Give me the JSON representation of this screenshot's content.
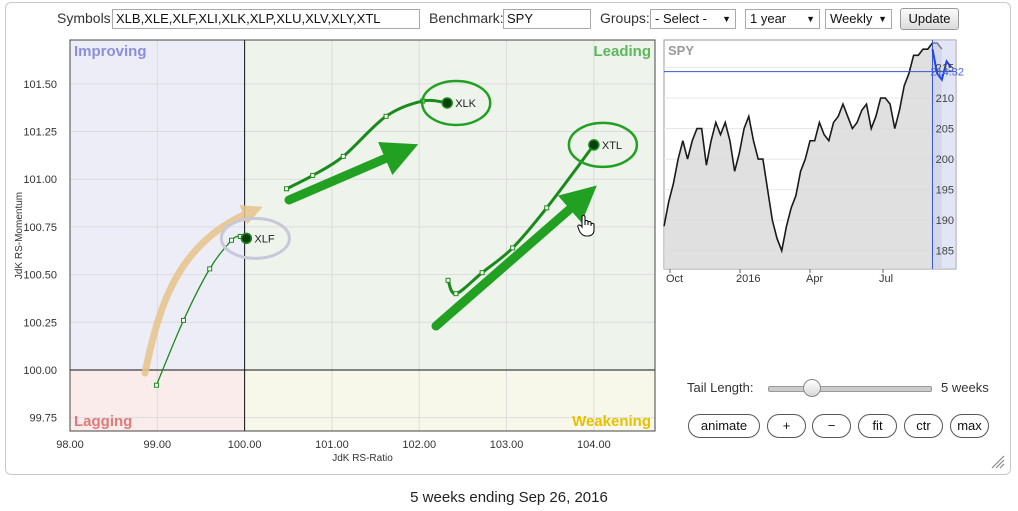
{
  "controls": {
    "symbols_label": "Symbols:",
    "symbols_value": "XLB,XLE,XLF,XLI,XLK,XLP,XLU,XLV,XLY,XTL",
    "benchmark_label": "Benchmark:",
    "benchmark_value": "SPY",
    "groups_label": "Groups:",
    "groups_value": "- Select -",
    "period_value": "1 year",
    "frequency_value": "Weekly",
    "update_label": "Update"
  },
  "playback": {
    "tail_label": "Tail Length:",
    "tail_value": "5 weeks",
    "tail_level": 5,
    "buttons": {
      "animate": "animate",
      "plus": "+",
      "minus": "−",
      "fit": "fit",
      "ctr": "ctr",
      "max": "max"
    }
  },
  "caption": "5 weeks ending Sep 26, 2016",
  "colors": {
    "improving": "#ededf8",
    "leading": "#eef4ec",
    "lagging": "#fbecec",
    "weakening": "#f8f8ea",
    "improving_text": "#8a8fd8",
    "leading_text": "#5cb85c",
    "lagging_text": "#e07a7a",
    "weakening_text": "#e8c000",
    "tail_color": "#1a8a1a",
    "arrow_color": "#22a022",
    "tan_arrow": "#e8c58a",
    "spy_line": "#1a1a1a",
    "spy_tail": "#2244dd"
  },
  "chart_data": [
    {
      "type": "scatter",
      "xlabel": "JdK RS-Ratio",
      "ylabel": "JdK RS-Momentum",
      "xlim": [
        98.0,
        104.7
      ],
      "ylim": [
        99.68,
        101.73
      ],
      "xticks": [
        "98.00",
        "99.00",
        "100.00",
        "101.00",
        "102.00",
        "103.00",
        "104.00"
      ],
      "yticks": [
        "99.75",
        "100.00",
        "100.25",
        "100.50",
        "100.75",
        "101.00",
        "101.25",
        "101.50"
      ],
      "quadrants": {
        "improving": "Improving",
        "leading": "Leading",
        "lagging": "Lagging",
        "weakening": "Weakening"
      },
      "series": [
        {
          "name": "XLF",
          "points": [
            [
              98.99,
              99.92
            ],
            [
              99.3,
              100.26
            ],
            [
              99.6,
              100.53
            ],
            [
              99.85,
              100.68
            ],
            [
              99.95,
              100.7
            ],
            [
              100.02,
              100.69
            ]
          ]
        },
        {
          "name": "XLK",
          "points": [
            [
              100.48,
              100.95
            ],
            [
              100.78,
              101.02
            ],
            [
              101.13,
              101.12
            ],
            [
              101.62,
              101.33
            ],
            [
              102.04,
              101.41
            ],
            [
              102.32,
              101.4
            ]
          ]
        },
        {
          "name": "XTL",
          "points": [
            [
              102.33,
              100.47
            ],
            [
              102.42,
              100.4
            ],
            [
              102.72,
              100.51
            ],
            [
              103.07,
              100.64
            ],
            [
              103.46,
              100.85
            ],
            [
              104.0,
              101.18
            ]
          ]
        }
      ]
    },
    {
      "type": "line",
      "title": "SPY",
      "x_labels": [
        "Oct",
        "2016",
        "Apr",
        "Jul"
      ],
      "yticks": [
        185,
        190,
        195,
        200,
        205,
        210,
        215
      ],
      "ylim": [
        182,
        219.5
      ],
      "last_value_label": "214.32",
      "last_value": 214.32,
      "series": [
        {
          "name": "SPY",
          "values": [
            189,
            193,
            196,
            200,
            203,
            200,
            203,
            205,
            205,
            199,
            203,
            206,
            204,
            206,
            203,
            198,
            201,
            205,
            207,
            203,
            200,
            200,
            195,
            190,
            187,
            185,
            189,
            192,
            194,
            198,
            200,
            203,
            203,
            206,
            204,
            203,
            206,
            207,
            209,
            207,
            205,
            206,
            208,
            209,
            205,
            207,
            210,
            210,
            209,
            205,
            208,
            212,
            214,
            217,
            217,
            218,
            218,
            219,
            219,
            218
          ]
        },
        {
          "name": "tail",
          "values": [
            218,
            214,
            213,
            216,
            215
          ]
        }
      ]
    }
  ]
}
